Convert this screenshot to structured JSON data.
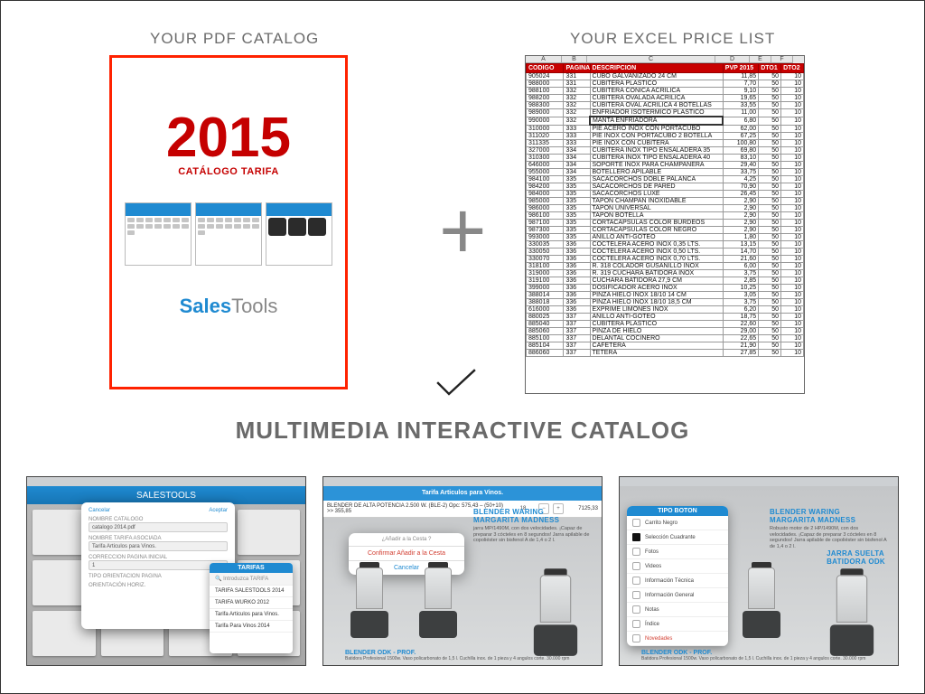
{
  "headings": {
    "pdf": "YOUR PDF CATALOG",
    "excel": "YOUR EXCEL PRICE LIST",
    "bottom": "MULTIMEDIA INTERACTIVE CATALOG"
  },
  "pdf": {
    "year": "2015",
    "sub": "CATÁLOGO TARIFA",
    "logo1": "Sales",
    "logo2": "Tools"
  },
  "excel": {
    "cols": [
      "A",
      "B",
      "C",
      "D",
      "E",
      "F"
    ],
    "headers": [
      "CODIGO",
      "PAGINA",
      "DESCRIPCION",
      "PVP 2015",
      "DTO1",
      "DTO2"
    ],
    "rows": [
      [
        "905024",
        "331",
        "CUBO GALVANIZADO 24 CM",
        "11,85",
        "50",
        "10"
      ],
      [
        "988000",
        "331",
        "CUBITERA PLASTICO",
        "7,70",
        "50",
        "10"
      ],
      [
        "988100",
        "332",
        "CUBITERA CÓNICA ACRÍLICA",
        "9,10",
        "50",
        "10"
      ],
      [
        "988200",
        "332",
        "CUBITERA OVALADA ACRÍLICA",
        "19,65",
        "50",
        "10"
      ],
      [
        "988300",
        "332",
        "CUBITERA OVAL ACRÍLICA 4 BOTELLAS",
        "33,55",
        "50",
        "10"
      ],
      [
        "989000",
        "332",
        "ENFRIADOR ISOTÉRMICO PLÁSTICO",
        "11,00",
        "50",
        "10"
      ],
      [
        "990000",
        "332",
        "MANTA ENFRIADORA",
        "6,80",
        "50",
        "10"
      ],
      [
        "310000",
        "333",
        "PIE ACERO INOX CON PORTACUBO",
        "62,00",
        "50",
        "10"
      ],
      [
        "311020",
        "333",
        "PIE INOX CON PORTACUBO 2 BOTELLA",
        "67,25",
        "50",
        "10"
      ],
      [
        "311335",
        "333",
        "PIE INOX CON CUBITERA",
        "100,80",
        "50",
        "10"
      ],
      [
        "327000",
        "334",
        "CUBITERA INOX TIPO ENSALADERA 35",
        "69,80",
        "50",
        "10"
      ],
      [
        "310300",
        "334",
        "CUBITERA INOX TIPO ENSALADERA 40",
        "83,10",
        "50",
        "10"
      ],
      [
        "646000",
        "334",
        "SOPORTE INOX PARA CHAMPAÑERA",
        "29,40",
        "50",
        "10"
      ],
      [
        "955000",
        "334",
        "BOTELLERO APILABLE",
        "33,75",
        "50",
        "10"
      ],
      [
        "984100",
        "335",
        "SACACORCHOS DOBLE PALANCA",
        "4,25",
        "50",
        "10"
      ],
      [
        "984200",
        "335",
        "SACACORCHOS DE PARED",
        "70,90",
        "50",
        "10"
      ],
      [
        "984000",
        "335",
        "SACACORCHOS LUXE",
        "26,45",
        "50",
        "10"
      ],
      [
        "985000",
        "335",
        "TAPON CHAMPAN INOXIDABLE",
        "2,90",
        "50",
        "10"
      ],
      [
        "986000",
        "335",
        "TAPON UNIVERSAL",
        "2,90",
        "50",
        "10"
      ],
      [
        "986100",
        "335",
        "TAPÓN BOTELLA",
        "2,90",
        "50",
        "10"
      ],
      [
        "987100",
        "335",
        "CORTACAPSULAS COLOR BURDEOS",
        "2,90",
        "50",
        "10"
      ],
      [
        "987300",
        "335",
        "CORTACAPSULAS COLOR NEGRO",
        "2,90",
        "50",
        "10"
      ],
      [
        "993000",
        "335",
        "ANILLO ANTI-GOTEO",
        "1,80",
        "50",
        "10"
      ],
      [
        "330035",
        "336",
        "COCTELERA ACERO INOX 0,35 LTS.",
        "13,15",
        "50",
        "10"
      ],
      [
        "330050",
        "336",
        "COCTELERA ACERO INOX 0,50 LTS.",
        "14,70",
        "50",
        "10"
      ],
      [
        "330070",
        "336",
        "COCTELERA ACERO INOX 0,70 LTS.",
        "21,60",
        "50",
        "10"
      ],
      [
        "318100",
        "336",
        "R. 318 COLADOR GUSANILLO INOX",
        "6,00",
        "50",
        "10"
      ],
      [
        "319000",
        "336",
        "R. 319 CUCHARA BATIDORA INOX",
        "3,75",
        "50",
        "10"
      ],
      [
        "319100",
        "336",
        "CUCHARA BATIDORA 27,9 CM",
        "2,85",
        "50",
        "10"
      ],
      [
        "399000",
        "336",
        "DOSIFICADOR ACERO INOX",
        "10,25",
        "50",
        "10"
      ],
      [
        "388014",
        "336",
        "PINZA HIELO INOX 18/10 14 CM",
        "3,05",
        "50",
        "10"
      ],
      [
        "388018",
        "336",
        "PINZA HIELO INOX 18/10 18,5 CM",
        "3,75",
        "50",
        "10"
      ],
      [
        "616000",
        "336",
        "EXPRIME LIMONES INOX",
        "6,20",
        "50",
        "10"
      ],
      [
        "880025",
        "337",
        "ANILLO ANTI-GOTEO",
        "18,75",
        "50",
        "10"
      ],
      [
        "885040",
        "337",
        "CUBITERA PLASTICO",
        "22,60",
        "50",
        "10"
      ],
      [
        "885060",
        "337",
        "PINZA DE HIELO",
        "29,00",
        "50",
        "10"
      ],
      [
        "885100",
        "337",
        "DELANTAL COCINERO",
        "22,65",
        "50",
        "10"
      ],
      [
        "885104",
        "337",
        "CAFETERA",
        "21,90",
        "50",
        "10"
      ],
      [
        "886060",
        "337",
        "TETERA",
        "27,85",
        "50",
        "10"
      ]
    ]
  },
  "thumb1": {
    "title": "SALESTOOLS",
    "sheet": {
      "cancel": "Cancelar",
      "accept": "Aceptar",
      "label1": "NOMBRE CATALOGO",
      "val1": "catalogo 2014.pdf",
      "label2": "NOMBRE TARIFA ASOCIADA",
      "val2": "Tarifa Articulos para Vinos.",
      "label3": "CORRECCION PAGINA INICIAL",
      "val3": "1",
      "label4": "TIPO ORIENTACION PAGINA",
      "label5": "ORIENTACIÓN HORIZ."
    },
    "popover": {
      "title": "TARIFAS",
      "search": "Introduzca TARIFA",
      "items": [
        "TARIFA SALESTOOLS 2014",
        "TARIFA WURKO 2012",
        "Tarifa Articulos para Vinos.",
        "Tarifa Para Vinos 2014"
      ]
    }
  },
  "thumb2": {
    "bar": "Tarifa Articulos para Vinos.",
    "row": {
      "name": "BLENDER DE ALTA POTENCIA 2.500 W. (BLE-2)  Opc: 575,43 – (50+10) >> 355,85",
      "qty": "18",
      "price": "7125,33"
    },
    "modal": {
      "q": "¿Añadir a la Cesta ?",
      "confirm": "Confirmar Añadir a la Cesta",
      "cancel": "Cancelar"
    },
    "right": {
      "title": "BLENDER WARING MARGARITA MADNESS",
      "desc": "jarra MP/1490M, con dos velocidades. ¡Capaz de preparar 3 cócteles en 8 segundos! Jarra apilable de copoliéster sin bisfenol A de 1,4 o 2 l."
    },
    "caption": {
      "title": "BLENDER ODK - PROF.",
      "desc": "Batidora Profesional 1500w. Vaso policarbonato de 1,5 l. Cuchilla inox. de 1 pieza y 4 angulos corte. 30.000 rpm"
    }
  },
  "thumb3": {
    "menu": {
      "title": "TIPO BOTON",
      "items": [
        "Carrito Negro",
        "Selección Cuadrante",
        "Fotos",
        "Videos",
        "Información Técnica",
        "Información General",
        "Notas",
        "Índice",
        "Novedades"
      ]
    },
    "right": {
      "title": "BLENDER WARING MARGARITA MADNESS",
      "desc": "Robusto motor de 2 HP/1490M, con dos velocidades. ¡Capaz de preparar 3 cócteles en 8 segundos! Jarra apilable de copoliéster sin bisfenol A de 1,4 o 2 l."
    },
    "jar": {
      "title": "JARRA SUELTA",
      "sub": "BATIDORA ODK"
    },
    "caption": {
      "title": "BLENDER ODK - PROF.",
      "desc": "Batidora Profesional 1500w. Vaso policarbonato de 1,5 l. Cuchilla inox. de 1 pieza y 4 angulos corte. 30.000 rpm"
    }
  }
}
